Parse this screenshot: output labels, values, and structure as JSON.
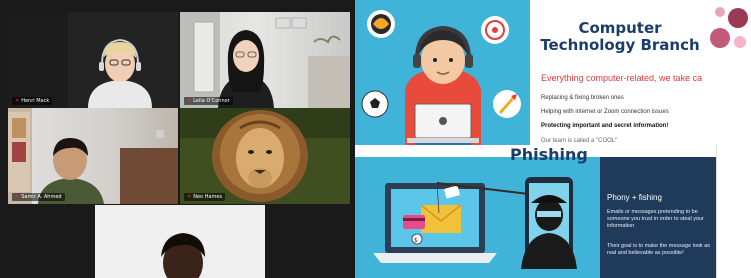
{
  "participants": [
    {
      "name": "Henri Mack"
    },
    {
      "name": "Leila O'Connor"
    },
    {
      "name": "Samir A. Ahmed"
    },
    {
      "name": "Neo Hames"
    },
    {
      "name": ""
    }
  ],
  "slide1": {
    "title_line1": "Computer",
    "title_line2": "Technology Branch",
    "tagline": "Everything computer-related, we take ca",
    "bullets": [
      "Replacing & fixing broken ones",
      "Helping with internet or Zoom connection issues",
      "Protecting important and secret information!",
      "Our team is called a \"COOL\""
    ]
  },
  "slide2": {
    "title": "Phishing",
    "panel_heading": "Phony + fishing",
    "panel_text_1": "Emails or messages pretending to be someone you trust in order to steal your information",
    "panel_text_2": "Their goal is to make the message look as real and believable as possible!"
  },
  "colors": {
    "slide_blue": "#3fb3d8",
    "title_navy": "#1b3d6d",
    "tagline_red": "#e43a3a",
    "panel_navy": "#1f3a5a"
  },
  "icons": [
    "gamepad-icon",
    "target-icon",
    "soccer-ball-icon",
    "rocket-icon",
    "laptop-icon",
    "hacker-icon",
    "fishing-rod-icon",
    "phone-icon",
    "envelope-icon",
    "credit-card-icon"
  ]
}
